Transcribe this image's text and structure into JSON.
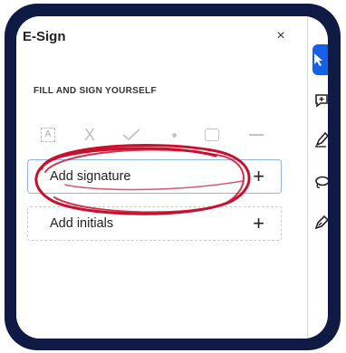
{
  "panel": {
    "title": "E-Sign",
    "close_glyph": "×",
    "section_title": "FILL AND SIGN YOURSELF"
  },
  "tools": {
    "text_field_glyph": "A",
    "cross_glyph": "X",
    "icons": [
      "text-field-icon",
      "cross-mark-icon",
      "checkmark-icon",
      "dot-icon",
      "rectangle-icon",
      "line-icon"
    ]
  },
  "actions": {
    "add_signature": "Add signature",
    "add_initials": "Add initials",
    "plus_glyph": "+"
  },
  "right_toolbar": {
    "icons": [
      "select-cursor-icon",
      "add-comment-icon",
      "draw-pen-icon",
      "lasso-icon",
      "sign-pen-icon"
    ]
  },
  "colors": {
    "frame": "#0f1b44",
    "accent": "#1460e6",
    "highlight_selection": "#8fb6e8",
    "annotation_ink": "#c8102e"
  }
}
